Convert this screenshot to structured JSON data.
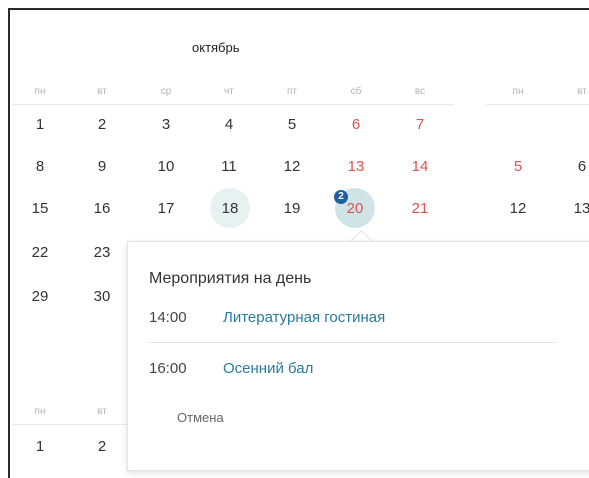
{
  "month": {
    "title": "октябрь"
  },
  "weekdays": [
    "пн",
    "вт",
    "ср",
    "чт",
    "пт",
    "сб",
    "вс"
  ],
  "next_weekdays": [
    "пн",
    "вт"
  ],
  "weeks": [
    [
      "1",
      "2",
      "3",
      "4",
      "5",
      "6",
      "7"
    ],
    [
      "8",
      "9",
      "10",
      "11",
      "12",
      "13",
      "14"
    ],
    [
      "15",
      "16",
      "17",
      "18",
      "19",
      "20",
      "21"
    ],
    [
      "22",
      "23"
    ],
    [
      "29",
      "30"
    ]
  ],
  "next_days": [
    "5",
    "6",
    "12",
    "13"
  ],
  "bottom_weekdays": [
    "пн",
    "вт"
  ],
  "bottom_days": [
    "1",
    "2"
  ],
  "selected_day": {
    "badge": "2"
  },
  "popup": {
    "title": "Мероприятия на день",
    "events": [
      {
        "time": "14:00",
        "name": "Литературная гостиная"
      },
      {
        "time": "16:00",
        "name": "Осенний бал"
      }
    ],
    "cancel_label": "Отмена"
  },
  "colors": {
    "weekend": "#d9534f",
    "link": "#2a7a9a",
    "badge": "#1f5f9a",
    "highlight": "#e6f1f1"
  }
}
